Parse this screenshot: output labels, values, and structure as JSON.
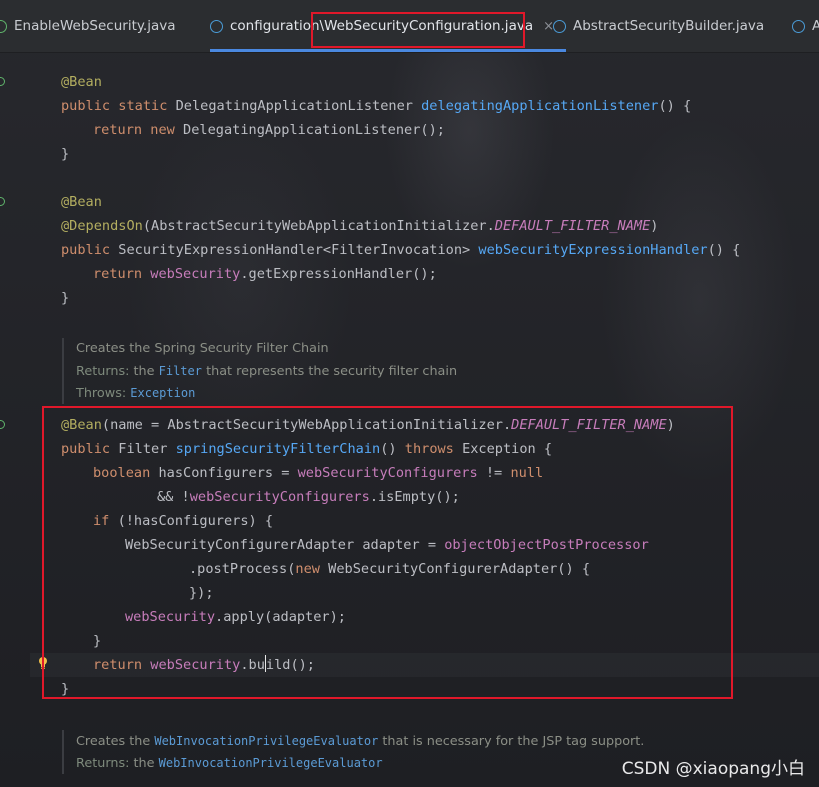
{
  "tabs": [
    {
      "label": "EnableWebSecurity.java",
      "icon": "annotation-class-icon",
      "active": false
    },
    {
      "label": "configuration\\WebSecurityConfiguration.java",
      "icon": "class-icon",
      "active": true,
      "close": "×"
    },
    {
      "label": "AbstractSecurityBuilder.java",
      "icon": "class-icon",
      "active": false
    },
    {
      "label": "A",
      "icon": "class-icon",
      "active": false
    }
  ],
  "code": {
    "l1": "@Bean",
    "l2_public": "public",
    "l2_static": "static",
    "l2_type": "DelegatingApplicationListener",
    "l2_name": "delegatingApplicationListener",
    "l2_tail": "() {",
    "l3_return": "return",
    "l3_new": "new",
    "l3_rest": "DelegatingApplicationListener();",
    "l4": "}",
    "l5": "@Bean",
    "l6_ann": "@DependsOn",
    "l6_open": "(AbstractSecurityWebApplicationInitializer.",
    "l6_const": "DEFAULT_FILTER_NAME",
    "l6_close": ")",
    "l7_public": "public",
    "l7_type": "SecurityExpressionHandler<FilterInvocation>",
    "l7_name": "webSecurityExpressionHandler",
    "l7_tail": "() {",
    "l8_return": "return",
    "l8_field": "webSecurity",
    "l8_rest": ".getExpressionHandler();",
    "l9": "}",
    "l10_ann": "@Bean",
    "l10_open": "(name = AbstractSecurityWebApplicationInitializer.",
    "l10_const": "DEFAULT_FILTER_NAME",
    "l10_close": ")",
    "l11_public": "public",
    "l11_type": "Filter",
    "l11_name": "springSecurityFilterChain",
    "l11_mid": "()",
    "l11_throws": "throws",
    "l11_tail": "Exception {",
    "l12_bool": "boolean",
    "l12_var": "hasConfigurers =",
    "l12_field": "webSecurityConfigurers",
    "l12_op": "!=",
    "l12_null": "null",
    "l13_op": "&& !",
    "l13_field": "webSecurityConfigurers",
    "l13_rest": ".isEmpty();",
    "l14_if": "if",
    "l14_rest": "(!hasConfigurers) {",
    "l15_decl": "WebSecurityConfigurerAdapter adapter =",
    "l15_field": "objectObjectPostProcessor",
    "l16_pre": ".postProcess(",
    "l16_new": "new",
    "l16_rest": "WebSecurityConfigurerAdapter() {",
    "l17": "});",
    "l18_field": "webSecurity",
    "l18_rest": ".apply(adapter);",
    "l19": "}",
    "l20_return": "return",
    "l20_field": "webSecurity",
    "l20_pre": ".bu",
    "l20_post": "ild();",
    "l21": "}"
  },
  "docs": {
    "filter_chain": {
      "line1": "Creates the Spring Security Filter Chain",
      "returns_label": "Returns:",
      "returns_pre": "the",
      "returns_ref": "Filter",
      "returns_post": "that represents the security filter chain",
      "throws_label": "Throws:",
      "throws_ref": "Exception"
    },
    "privilege": {
      "line1_pre": "Creates the",
      "line1_ref": "WebInvocationPrivilegeEvaluator",
      "line1_post": "that is necessary for the JSP tag support.",
      "returns_label": "Returns:",
      "returns_pre": "the",
      "returns_ref": "WebInvocationPrivilegeEvaluator"
    }
  },
  "watermark": "CSDN @xiaopang小白",
  "colors": {
    "highlight_box": "#e0182a",
    "keyword": "#cf8e6d",
    "annotation": "#b3ae60",
    "method": "#56a8f5",
    "field": "#c77dbb"
  }
}
